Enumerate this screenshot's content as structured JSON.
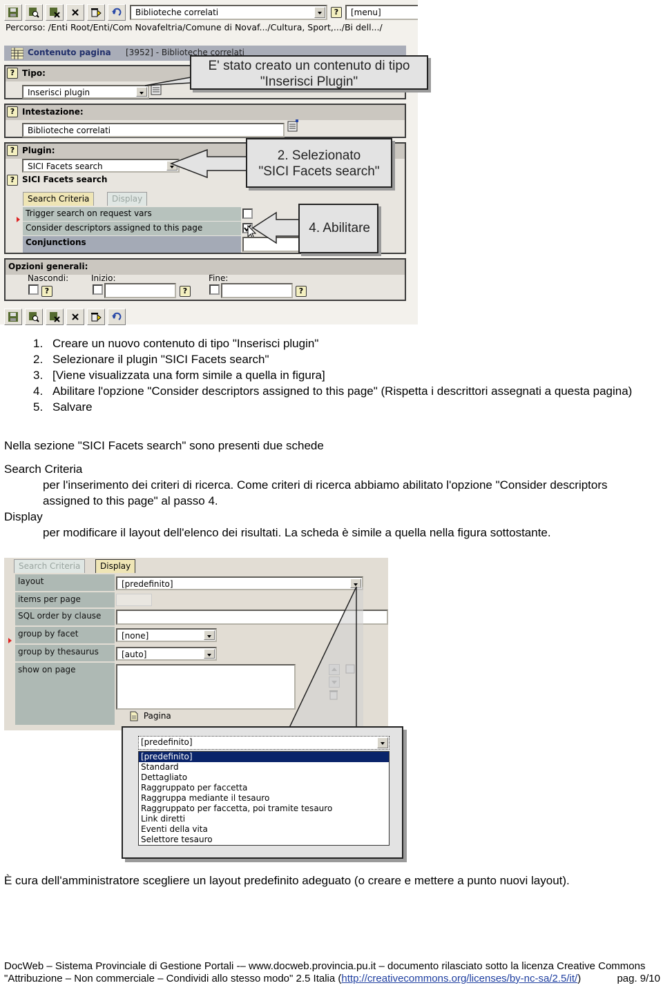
{
  "screenshot1": {
    "toolbar": {
      "icons": [
        "save-icon",
        "preview-icon",
        "save-close-icon",
        "close-icon",
        "delete-icon",
        "undo-icon"
      ],
      "page_select_value": "Biblioteche correlati",
      "menu_select_value": "[menu]"
    },
    "breadcrumb": "Percorso: /Enti Root/Enti/Com Novafeltria/Comune di Novaf.../Cultura, Sport,.../Bi dell.../",
    "content_header": {
      "label": "Contenuto pagina",
      "id": "[3952] - Biblioteche correlati"
    },
    "tipo": {
      "label": "Tipo:",
      "value": "Inserisci plugin"
    },
    "intestazione": {
      "label": "Intestazione:",
      "value": "Biblioteche correlati"
    },
    "plugin": {
      "label": "Plugin:",
      "value": "SICI Facets search",
      "section_title": "SICI Facets search"
    },
    "tabs": [
      {
        "label": "Search Criteria",
        "active": true
      },
      {
        "label": "Display",
        "active": false
      }
    ],
    "criteria_rows": [
      {
        "label": "Trigger search on request vars",
        "checked": false
      },
      {
        "label": "Consider descriptors assigned to this page",
        "checked": true
      },
      {
        "label": "Conjunctions",
        "value": ""
      }
    ],
    "general_options": {
      "label": "Opzioni generali:",
      "nascondi": "Nascondi:",
      "inizio": "Inizio:",
      "fine": "Fine:"
    },
    "callouts": {
      "c1_line1": "E' stato creato un contenuto di tipo",
      "c1_line2": "\"Inserisci Plugin\"",
      "c2_line1": "2. Selezionato",
      "c2_line2": "\"SICI Facets search\"",
      "c4": "4. Abilitare"
    }
  },
  "steps": [
    {
      "num": "1.",
      "text": "Creare un nuovo contenuto di tipo \"Inserisci plugin\""
    },
    {
      "num": "2.",
      "text": "Selezionare il plugin \"SICI Facets search\""
    },
    {
      "num": "3.",
      "text": "[Viene visualizzata una form simile a quella in figura]"
    },
    {
      "num": "4.",
      "text": "Abilitare l'opzione \"Consider descriptors assigned to this page\" (Rispetta i descrittori assegnati a questa pagina)"
    },
    {
      "num": "5.",
      "text": "Salvare"
    }
  ],
  "intro": "Nella sezione \"SICI Facets search\" sono presenti due schede",
  "definitions": [
    {
      "term": "Search Criteria",
      "desc": "per l'inserimento dei criteri di ricerca. Come criteri di ricerca abbiamo abilitato l'opzione \"Consider descriptors assigned to this page\" al passo 4."
    },
    {
      "term": "Display",
      "desc": "per modificare il layout dell'elenco dei risultati. La scheda è simile a quella nella figura sottostante."
    }
  ],
  "screenshot2": {
    "tabs": [
      {
        "label": "Search Criteria",
        "active": false
      },
      {
        "label": "Display",
        "active": true
      }
    ],
    "fields": [
      {
        "label": "layout",
        "value": "[predefinito]"
      },
      {
        "label": "items per page",
        "value": ""
      },
      {
        "label": "SQL order by clause",
        "value": ""
      },
      {
        "label": "group by facet",
        "value": "[none]"
      },
      {
        "label": "group by thesaurus",
        "value": "[auto]"
      },
      {
        "label": "show on page",
        "value": ""
      }
    ],
    "page_item": "Pagina",
    "dropdown": {
      "selected": "[predefinito]",
      "options": [
        "[predefinito]",
        "Standard",
        "Dettagliato",
        "Raggruppato per faccetta",
        "Raggruppa mediante il tesauro",
        "Raggruppato per faccetta, poi tramite tesauro",
        "Link diretti",
        "Eventi della vita",
        "Selettore tesauro"
      ]
    }
  },
  "closing": "È cura dell'amministratore scegliere un layout predefinito adeguato (o creare e mettere a punto nuovi layout).",
  "footer": {
    "text": "DocWeb – Sistema Provinciale di Gestione Portali -– www.docweb.provincia.pu.it – documento rilasciato sotto la licenza Creative Commons \"Attribuzione – Non commerciale – Condividi allo stesso modo\" 2.5 Italia (",
    "link": "http://creativecommons.org/licenses/by-nc-sa/2.5/it/",
    "text_end": ")",
    "page": "pag. 9/10"
  }
}
